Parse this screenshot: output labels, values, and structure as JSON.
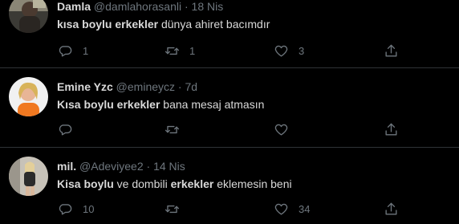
{
  "tweets": [
    {
      "name": "Damla",
      "handle": "@damlahorasanli",
      "separator": "·",
      "date": "18 Nis",
      "text_segments": [
        {
          "text": "kısa boylu erkekler",
          "bold": true
        },
        {
          "text": " dünya ahiret bacımdır",
          "bold": false
        }
      ],
      "reply_count": "1",
      "retweet_count": "1",
      "like_count": "3"
    },
    {
      "name": "Emine Yzc",
      "handle": "@emineycz",
      "separator": "·",
      "date": "7d",
      "text_segments": [
        {
          "text": "Kısa boylu erkekler",
          "bold": true
        },
        {
          "text": " bana mesaj atmasın",
          "bold": false
        }
      ],
      "reply_count": "",
      "retweet_count": "",
      "like_count": ""
    },
    {
      "name": "mil.",
      "handle": "@Adeviyee2",
      "separator": "·",
      "date": "14 Nis",
      "text_segments": [
        {
          "text": "Kisa boylu",
          "bold": true
        },
        {
          "text": " ve dombili ",
          "bold": false
        },
        {
          "text": "erkekler",
          "bold": true
        },
        {
          "text": " eklemesin beni",
          "bold": false
        }
      ],
      "reply_count": "10",
      "retweet_count": "",
      "like_count": "34"
    }
  ],
  "icons": {
    "reply": "reply-icon",
    "retweet": "retweet-icon",
    "like": "heart-icon",
    "share": "share-icon"
  },
  "colors": {
    "background": "#000000",
    "text": "#d9d9d9",
    "muted": "#6e767d",
    "divider": "#2f3336"
  }
}
